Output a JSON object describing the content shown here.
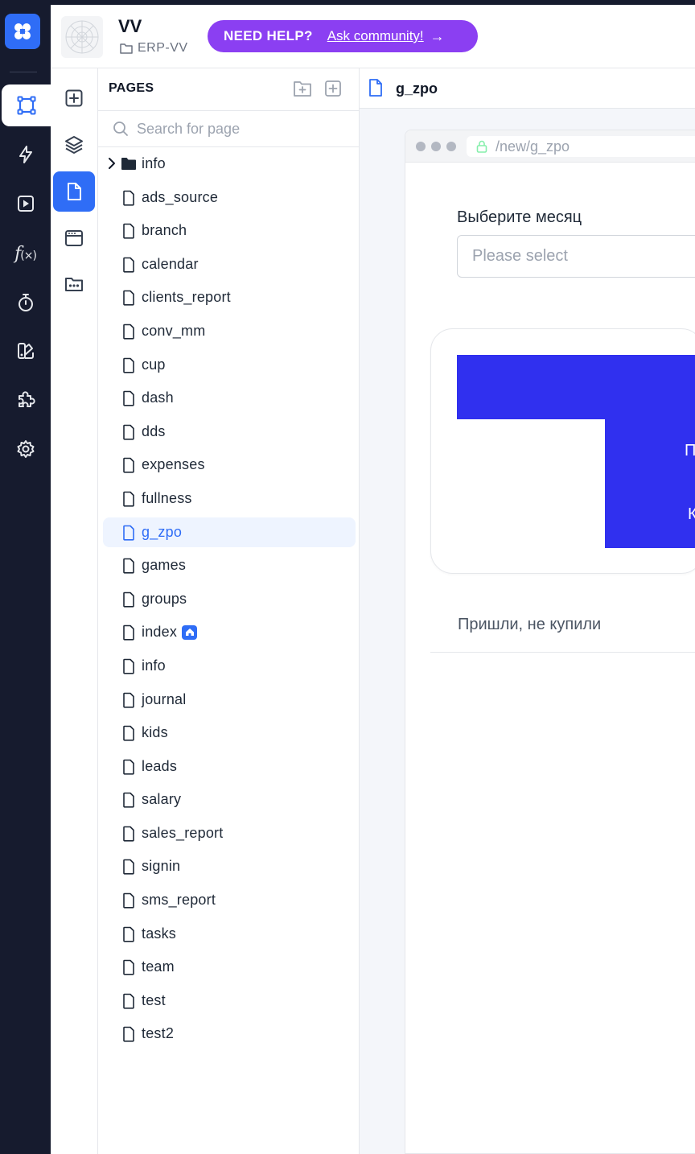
{
  "app": {
    "name": "VV",
    "folder": "ERP-VV"
  },
  "help": {
    "strong": "NEED HELP?",
    "link": "Ask community!"
  },
  "pages_panel": {
    "title": "PAGES",
    "search_placeholder": "Search for page",
    "folder": "info",
    "items": [
      "ads_source",
      "branch",
      "calendar",
      "clients_report",
      "conv_mm",
      "cup",
      "dash",
      "dds",
      "expenses",
      "fullness",
      "g_zpo",
      "games",
      "groups",
      "index",
      "info",
      "journal",
      "kids",
      "leads",
      "salary",
      "sales_report",
      "signin",
      "sms_report",
      "tasks",
      "team",
      "test",
      "test2"
    ],
    "selected": "g_zpo",
    "home_page": "index"
  },
  "editor": {
    "tab_label": "g_zpo",
    "url": "/new/g_zpo",
    "month_label": "Выберите месяц",
    "month_placeholder": "Please select",
    "card_text_1": "П",
    "card_text_2": "К",
    "stat_label": "Пришли, не купили"
  },
  "colors": {
    "accent": "#2f6df6",
    "rail_bg": "#161b2e",
    "help_pill": "#8b3ff2",
    "block": "#3030ef"
  }
}
